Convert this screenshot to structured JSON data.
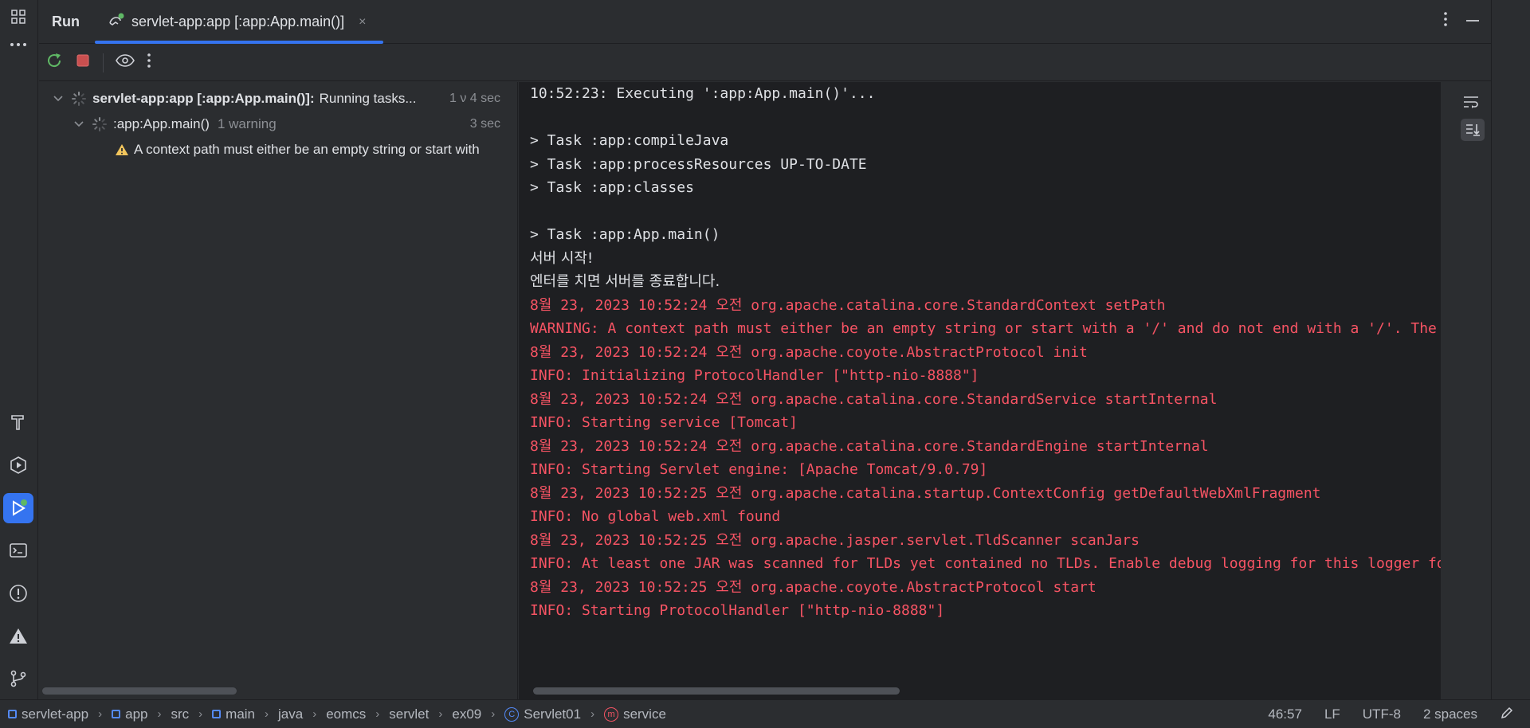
{
  "header": {
    "run_label": "Run",
    "tab_label": "servlet-app:app [:app:App.main()]",
    "tab_close": "×"
  },
  "tree": {
    "root": {
      "name": "servlet-app:app [:app:App.main()]:",
      "status": "Running tasks...",
      "time": "1 ν 4 sec"
    },
    "child": {
      "name": ":app:App.main()",
      "note": "1 warning",
      "time": "3 sec"
    },
    "warning": {
      "text": "A context path must either be an empty string or start with"
    }
  },
  "console": {
    "lines": [
      {
        "text": "10:52:23: Executing ':app:App.main()'...",
        "kind": "norm"
      },
      {
        "text": "",
        "kind": "norm"
      },
      {
        "text": "> Task :app:compileJava",
        "kind": "norm"
      },
      {
        "text": "> Task :app:processResources UP-TO-DATE",
        "kind": "norm"
      },
      {
        "text": "> Task :app:classes",
        "kind": "norm"
      },
      {
        "text": "",
        "kind": "norm"
      },
      {
        "text": "> Task :app:App.main()",
        "kind": "norm"
      },
      {
        "text": "서버 시작!",
        "kind": "norm kor"
      },
      {
        "text": "엔터를 치면 서버를 종료합니다.",
        "kind": "norm kor"
      },
      {
        "text": "8월 23, 2023 10:52:24 오전 org.apache.catalina.core.StandardContext setPath",
        "kind": "err"
      },
      {
        "text": "WARNING: A context path must either be an empty string or start with a '/' and do not end with a '/'. The path [/] does not meet these criteria and has been changed to []",
        "kind": "err"
      },
      {
        "text": "8월 23, 2023 10:52:24 오전 org.apache.coyote.AbstractProtocol init",
        "kind": "err"
      },
      {
        "text": "INFO: Initializing ProtocolHandler [\"http-nio-8888\"]",
        "kind": "err"
      },
      {
        "text": "8월 23, 2023 10:52:24 오전 org.apache.catalina.core.StandardService startInternal",
        "kind": "err"
      },
      {
        "text": "INFO: Starting service [Tomcat]",
        "kind": "err"
      },
      {
        "text": "8월 23, 2023 10:52:24 오전 org.apache.catalina.core.StandardEngine startInternal",
        "kind": "err"
      },
      {
        "text": "INFO: Starting Servlet engine: [Apache Tomcat/9.0.79]",
        "kind": "err"
      },
      {
        "text": "8월 23, 2023 10:52:25 오전 org.apache.catalina.startup.ContextConfig getDefaultWebXmlFragment",
        "kind": "err"
      },
      {
        "text": "INFO: No global web.xml found",
        "kind": "err"
      },
      {
        "text": "8월 23, 2023 10:52:25 오전 org.apache.jasper.servlet.TldScanner scanJars",
        "kind": "err"
      },
      {
        "text": "INFO: At least one JAR was scanned for TLDs yet contained no TLDs. Enable debug logging for this logger for a complete list of JARs that were scanned but no TLDs were found in them.",
        "kind": "err"
      },
      {
        "text": "8월 23, 2023 10:52:25 오전 org.apache.coyote.AbstractProtocol start",
        "kind": "err"
      },
      {
        "text": "INFO: Starting ProtocolHandler [\"http-nio-8888\"]",
        "kind": "err"
      }
    ]
  },
  "breadcrumbs": [
    {
      "label": "servlet-app",
      "icon": "module-icon"
    },
    {
      "label": "app",
      "icon": "module-icon"
    },
    {
      "label": "src",
      "icon": ""
    },
    {
      "label": "main",
      "icon": "module-icon"
    },
    {
      "label": "java",
      "icon": ""
    },
    {
      "label": "eomcs",
      "icon": ""
    },
    {
      "label": "servlet",
      "icon": ""
    },
    {
      "label": "ex09",
      "icon": ""
    },
    {
      "label": "Servlet01",
      "icon": "class-icon"
    },
    {
      "label": "service",
      "icon": "method-icon"
    }
  ],
  "status": {
    "position": "46:57",
    "line_ending": "LF",
    "encoding": "UTF-8",
    "indent": "2 spaces"
  },
  "colors": {
    "accent": "#3574f0",
    "error_text": "#f75464",
    "warning": "#f2c55c",
    "running": "#5fb865"
  }
}
